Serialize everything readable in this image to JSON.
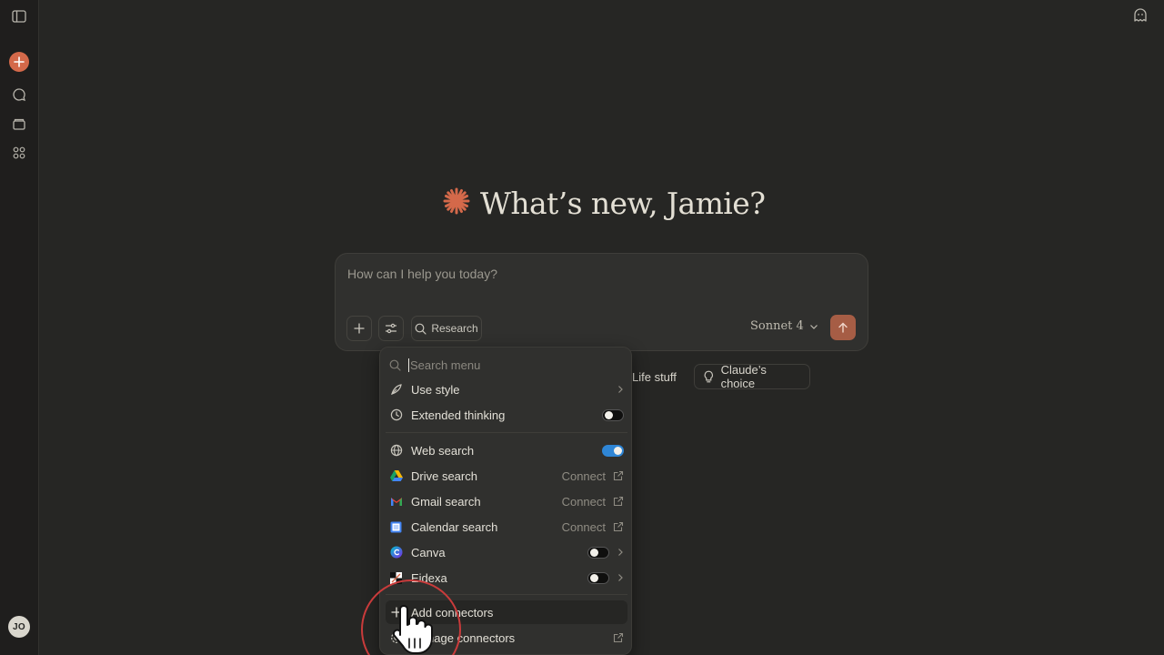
{
  "greeting": "What’s new, Jamie?",
  "composer": {
    "placeholder": "How can I help you today?",
    "research_label": "Research",
    "model_label": "Sonnet 4"
  },
  "chips": [
    {
      "label": "Life stuff"
    },
    {
      "label": "Claude’s choice"
    }
  ],
  "user": {
    "initials": "JO"
  },
  "menu": {
    "search_placeholder": "Search menu",
    "items": [
      {
        "label": "Use style"
      },
      {
        "label": "Extended thinking",
        "toggle": "off"
      },
      {
        "label": "Web search",
        "toggle": "on"
      },
      {
        "label": "Drive search",
        "action": "Connect"
      },
      {
        "label": "Gmail search",
        "action": "Connect"
      },
      {
        "label": "Calendar search",
        "action": "Connect"
      },
      {
        "label": "Canva",
        "toggle": "off"
      },
      {
        "label": "Eidexa",
        "toggle": "off"
      },
      {
        "label": "Add connectors"
      },
      {
        "label": "Manage connectors"
      }
    ]
  },
  "colors": {
    "accent": "#d4694a",
    "send": "#a65d45",
    "toggle_on": "#2f86d6",
    "background": "#262624"
  }
}
